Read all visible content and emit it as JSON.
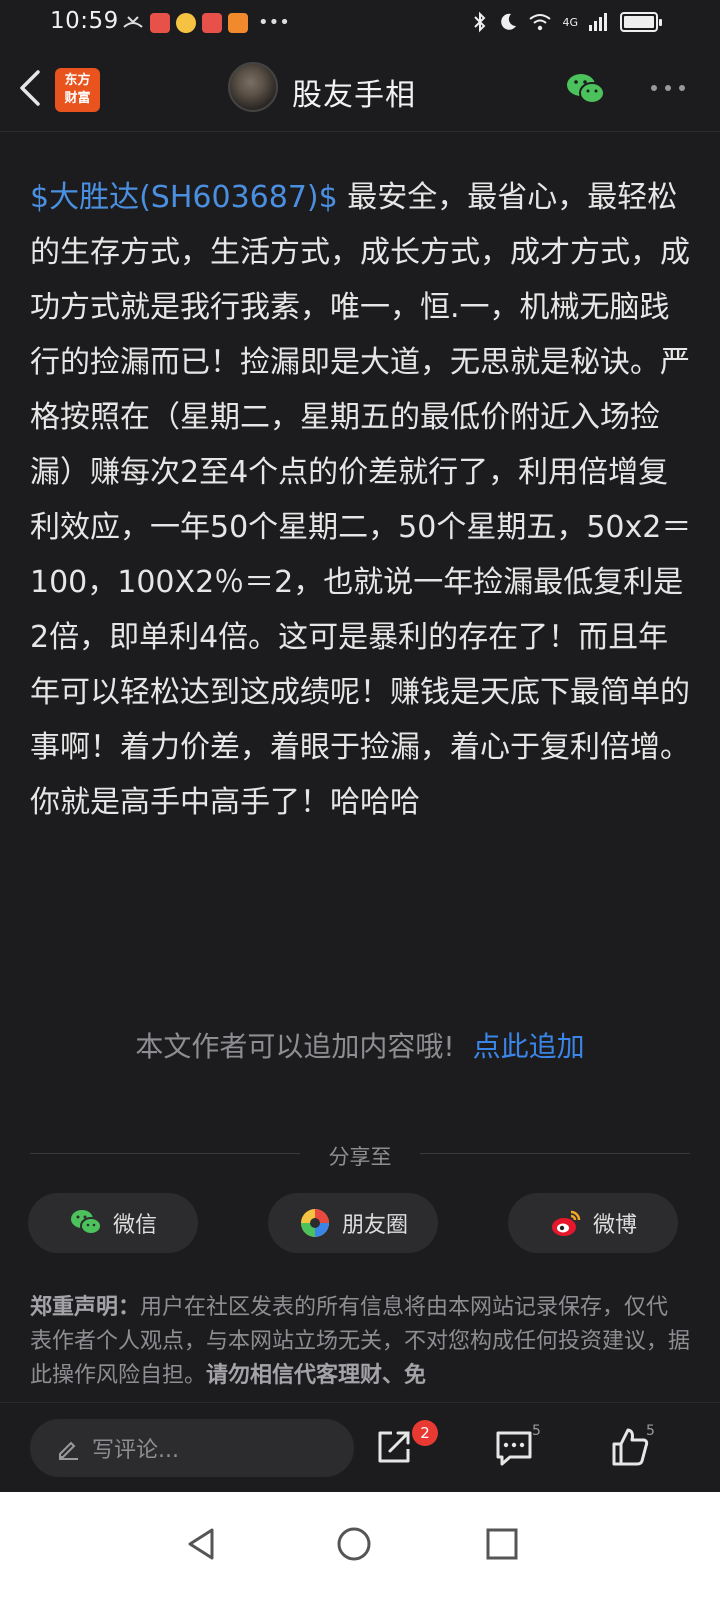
{
  "status_bar": {
    "time": "10:59",
    "network": "4G"
  },
  "header": {
    "logo_text_line1": "东方",
    "logo_text_line2": "财富",
    "title": "股友手相"
  },
  "article": {
    "stock_tag": "$大胜达(SH603687)$",
    "body": " 最安全，最省心，最轻松的生存方式，生活方式，成长方式，成才方式，成功方式就是我行我素，唯一，恒.一，机械无脑践行的捡漏而已！捡漏即是大道，无思就是秘诀。严格按照在（星期二，星期五的最低价附近入场捡漏）赚每次2至4个点的价差就行了，利用倍增复利效应，一年50个星期二，50个星期五，50x2＝100，100X2％＝2，也就说一年捡漏最低复利是2倍，即单利4倍。这可是暴利的存在了！而且年年可以轻松达到这成绩呢！赚钱是天底下最简单的事啊！着力价差，着眼于捡漏，着心于复利倍增。你就是高手中高手了！哈哈哈"
  },
  "append": {
    "text": "本文作者可以追加内容哦!",
    "link": "点此追加"
  },
  "share": {
    "label": "分享至",
    "buttons": [
      {
        "label": "微信",
        "icon": "wechat-icon"
      },
      {
        "label": "朋友圈",
        "icon": "moments-icon"
      },
      {
        "label": "微博",
        "icon": "weibo-icon"
      }
    ]
  },
  "disclaimer": {
    "title": "郑重声明：",
    "text": "用户在社区发表的所有信息将由本网站记录保存，仅代表作者个人观点，与本网站立场无关，不对您构成任何投资建议，据此操作风险自担。",
    "bold_tail": "请勿相信代客理财、免"
  },
  "action_bar": {
    "comment_placeholder": "写评论...",
    "share_badge": "2",
    "comment_count": "5",
    "like_count": "5"
  },
  "colors": {
    "background": "#1c1c1e",
    "link_blue": "#4a8fe0",
    "badge_red": "#e83a33"
  }
}
